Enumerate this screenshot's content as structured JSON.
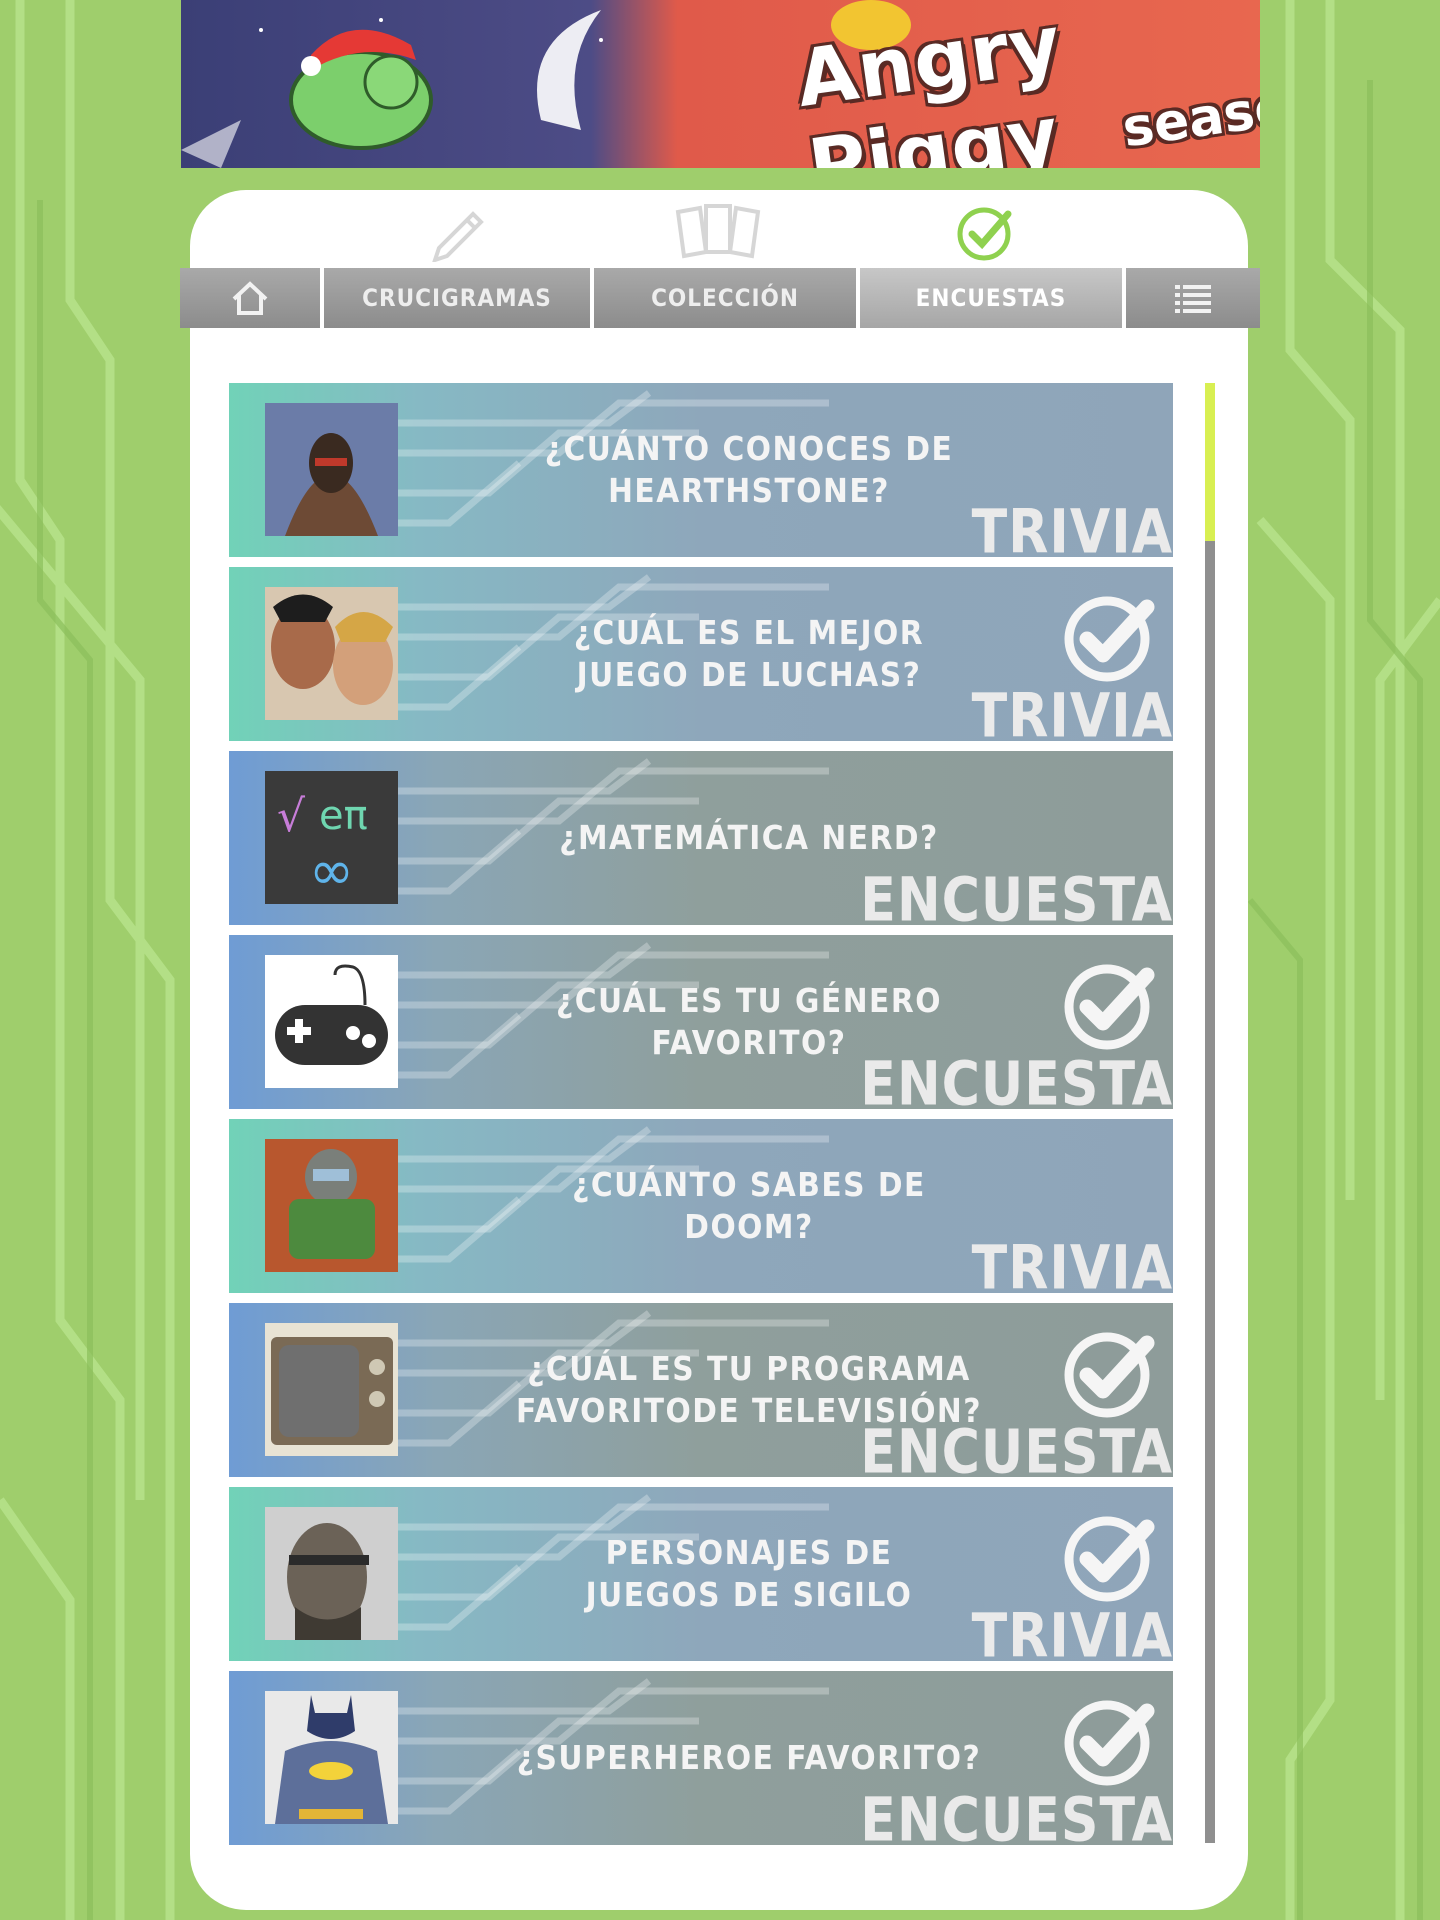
{
  "banner": {
    "title": "Angry Piggy",
    "subtitle": "season"
  },
  "top_icons": [
    "pencil-icon",
    "cards-icon",
    "check-circle-icon"
  ],
  "nav": {
    "home_icon": "home-icon",
    "tabs": [
      {
        "label": "CRUCIGRAMAS"
      },
      {
        "label": "COLECCIÓN"
      },
      {
        "label": "ENCUESTAS",
        "active": true
      }
    ],
    "menu_icon": "list-icon"
  },
  "colors": {
    "accent_green": "#8fd14f",
    "scroll_thumb": "#d8ef52",
    "tab_gray": "#9a9a9a"
  },
  "items": [
    {
      "title": "¿CUÁNTO CONOCES DE\nHEARTHSTONE?",
      "type": "TRIVIA",
      "completed": false,
      "thumb": "hooded-warrior-image"
    },
    {
      "title": "¿CUÁL ES EL MEJOR\nJUEGO DE LUCHAS?",
      "type": "TRIVIA",
      "completed": true,
      "thumb": "fighters-image"
    },
    {
      "title": "¿MATEMÁTICA NERD?",
      "type": "ENCUESTA",
      "completed": false,
      "thumb": "math-symbols-image"
    },
    {
      "title": "¿CUÁL ES TU GÉNERO\nFAVORITO?",
      "type": "ENCUESTA",
      "completed": true,
      "thumb": "gamepad-image"
    },
    {
      "title": "¿CUÁNTO SABES DE DOOM?",
      "type": "TRIVIA",
      "completed": false,
      "thumb": "doom-marine-image"
    },
    {
      "title": "¿CUÁL ES TU PROGRAMA\nFAVORITODE TELEVISIÓN?",
      "type": "ENCUESTA",
      "completed": true,
      "thumb": "tv-image"
    },
    {
      "title": "PERSONAJES DE\nJUEGOS DE SIGILO",
      "type": "TRIVIA",
      "completed": true,
      "thumb": "stealth-soldier-image"
    },
    {
      "title": "¿SUPERHEROE FAVORITO?",
      "type": "ENCUESTA",
      "completed": true,
      "thumb": "batman-image"
    }
  ]
}
